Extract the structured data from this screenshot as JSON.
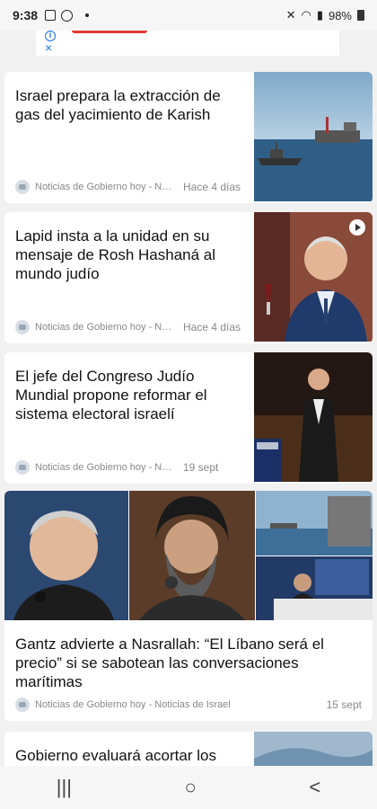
{
  "status": {
    "time": "9:38",
    "battery": "98%"
  },
  "ad": {
    "info_icon": "info-icon",
    "close_label": "×"
  },
  "articles": [
    {
      "title": "Israel prepara la extracción de gas del yacimiento de Karish",
      "source": "Noticias de Gobierno hoy - Noticias de Israel",
      "time": "Hace 4 días"
    },
    {
      "title": "Lapid insta a la unidad en su mensaje de Rosh Hashaná al mundo judío",
      "source": "Noticias de Gobierno hoy - Noticias de Israel",
      "time": "Hace 4 días"
    },
    {
      "title": "El jefe del Congreso Judío Mundial propone reformar el sistema electoral israelí",
      "source": "Noticias de Gobierno hoy - Noticias de Israel",
      "time": "19 sept"
    },
    {
      "title": "Gantz advierte a Nasrallah: “El Líbano será el precio” si se sabotean las conversaciones marítimas",
      "source": "Noticias de Gobierno hoy - Noticias de Israel",
      "time": "15 sept"
    },
    {
      "title": "Gobierno evaluará acortar los"
    }
  ],
  "nav": {
    "recents": "|||",
    "home": "○",
    "back": "<"
  }
}
